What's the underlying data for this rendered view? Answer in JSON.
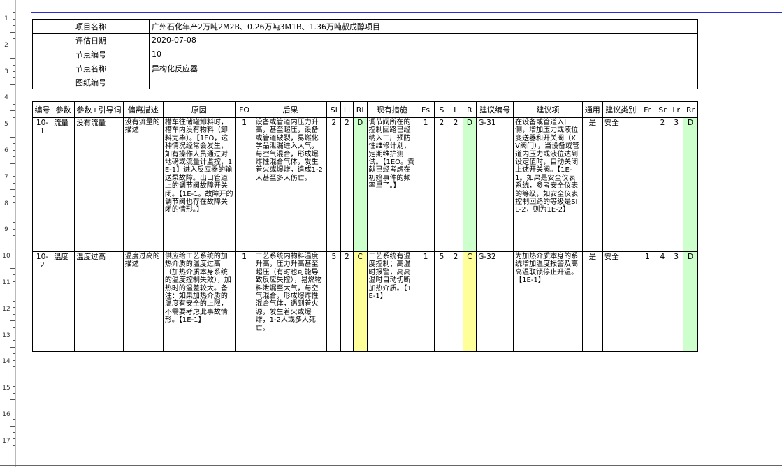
{
  "ruler": {
    "numbers": [
      "1",
      "2",
      "3",
      "4",
      "5",
      "6",
      "7",
      "8",
      "9",
      "10",
      "11",
      "12",
      "13",
      "14",
      "15",
      "16",
      "17"
    ]
  },
  "info": {
    "rows": [
      {
        "label": "项目名称",
        "value": "广州石化年产2万吨2M2B、0.26万吨3M1B、1.36万吨叔戊醇项目"
      },
      {
        "label": "评估日期",
        "value": "2020-07-08"
      },
      {
        "label": "节点编号",
        "value": "10"
      },
      {
        "label": "节点名称",
        "value": "异构化反应器"
      },
      {
        "label": "图纸编号",
        "value": ""
      }
    ]
  },
  "table": {
    "headers": [
      "编号",
      "参数",
      "参数+引导词",
      "偏离描述",
      "原因",
      "FO",
      "后果",
      "Si",
      "Li",
      "Ri",
      "现有措施",
      "Fs",
      "S",
      "L",
      "R",
      "建议编号",
      "建议项",
      "通用",
      "建议类别",
      "Fr",
      "Sr",
      "Lr",
      "Rr"
    ],
    "rows": [
      {
        "id": "10-1",
        "param": "流量",
        "guide": "没有流量",
        "deviation": "没有流量的描述",
        "cause": "槽车往储罐卸料时，槽车内没有物料（卸料完毕）。【1EO，这种情况经常会发生，如有操作人员通过对地磅或流量计监控，1E-1】进入反应器的输送泵故障。出口管道上的调节阀故障开关闭。【1E-1。故障开的调节阀也存在故障关闭的情形。】",
        "fo": "1",
        "consequence": "设备或管道内压力升高，甚至超压，设备或管道破裂，易燃化学品泄漏进入大气，与空气混合，形成爆炸性混合气体，发生着火或爆炸，造成1-2人甚至多人伤亡。",
        "si": "2",
        "li": "2",
        "ri": "D",
        "measures": "调节阀所在的控制回路已经纳入工厂预防性维修计划，定期维护测试。【1EO。贡献已经考虑在初始事件的频率里了。】",
        "fs": "1",
        "s": "2",
        "l": "2",
        "r": "D",
        "rec_no": "G-31",
        "recommendation": "在设备或管道入口侧，增加压力或液位变送器和开关阀（XV阀门），当设备或管道内压力或液位达到设定值时，自动关闭上述开关阀。【1E-1。如果是安全仪表系统，参考安全仪表的等级，如安全仪表控制回路的等级是SIL-2，则为1E-2】",
        "general": "是",
        "category": "安全",
        "fr": "",
        "sr": "2",
        "lr": "3",
        "rr": "D"
      },
      {
        "id": "10-2",
        "param": "温度",
        "guide": "温度过高",
        "deviation": "温度过高的描述",
        "cause": "供应给工艺系统的加热介质的温度过高（加热介质本身系统的温度控制失效），加热时的温差较大。备注：如果加热介质的温度有安全的上限，不需要考虑此事故情形。【1E-1】",
        "fo": "1",
        "consequence": "工艺系统内物料温度升高，压力升高甚至超压（有时也可能导致反应失控），易燃物料泄漏至大气，与空气混合，形成爆炸性混合气体，遇到着火源，发生着火或爆炸，1-2人或多人死亡。",
        "si": "5",
        "li": "2",
        "ri": "C",
        "measures": "工艺系统有温度控制；高温时报警，高高温时自动切断加热介质。【1E-1】",
        "fs": "1",
        "s": "5",
        "l": "2",
        "r": "C",
        "rec_no": "G-32",
        "recommendation": "为加热介质本身的系统增加温度报警及高高温联锁停止升温。【1E-1】",
        "general": "是",
        "category": "安全",
        "fr": "1",
        "sr": "4",
        "lr": "3",
        "rr": "D"
      }
    ]
  }
}
